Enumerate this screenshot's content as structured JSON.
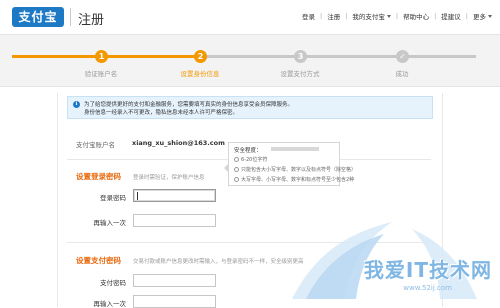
{
  "header": {
    "logo_text": "支付宝",
    "page_title": "注册",
    "nav": [
      {
        "label": "登录"
      },
      {
        "label": "注册"
      },
      {
        "label": "我的支付宝",
        "dropdown": true
      },
      {
        "label": "帮助中心"
      },
      {
        "label": "提建议"
      },
      {
        "label": "更多",
        "dropdown": true
      }
    ]
  },
  "steps": [
    {
      "number": "1",
      "label": "验证账户名",
      "status": "done"
    },
    {
      "number": "2",
      "label": "设置身份信息",
      "status": "active"
    },
    {
      "number": "3",
      "label": "设置支付方式",
      "status": "todo"
    },
    {
      "number": "",
      "label": "成功",
      "status": "todo",
      "icon": "check-icon"
    }
  ],
  "colors": {
    "accent_orange": "#f39800",
    "title_orange": "#e8680c",
    "brand_blue": "#1d79c4",
    "inactive_gray": "#c8c8c8"
  },
  "notice": {
    "icon": "info-icon",
    "line1": "为了给您提供更好的支付和金融服务，您需要填写真实的身份信息享受会员保障服务。",
    "line2": "身份信息一经录入不可更改，隐私信息未经本人许可严格保密。"
  },
  "account": {
    "label": "支付宝账户名",
    "value": "xiang_xu_shion@163.com"
  },
  "login_password": {
    "title": "设置登录密码",
    "hint": "登录时需验证，保护账户信息",
    "password_label": "登录密码",
    "confirm_label": "再输入一次",
    "password_value": "",
    "confirm_value": ""
  },
  "strength": {
    "title": "安全程度：",
    "rules": [
      "6-20位字符",
      "只能包含大小写字母、数字以及标点符号（除空格）",
      "大写字母、小写字母、数字和标点符号至少包含2种"
    ]
  },
  "pay_password": {
    "title": "设置支付密码",
    "hint": "交易付款或账户信息更改时需输入，与登录密码不一样，安全级别更高",
    "password_label": "支付密码",
    "confirm_label": "再输入一次"
  },
  "watermark": {
    "text": "我爱IT技术网",
    "url": "www.52ij.com"
  }
}
